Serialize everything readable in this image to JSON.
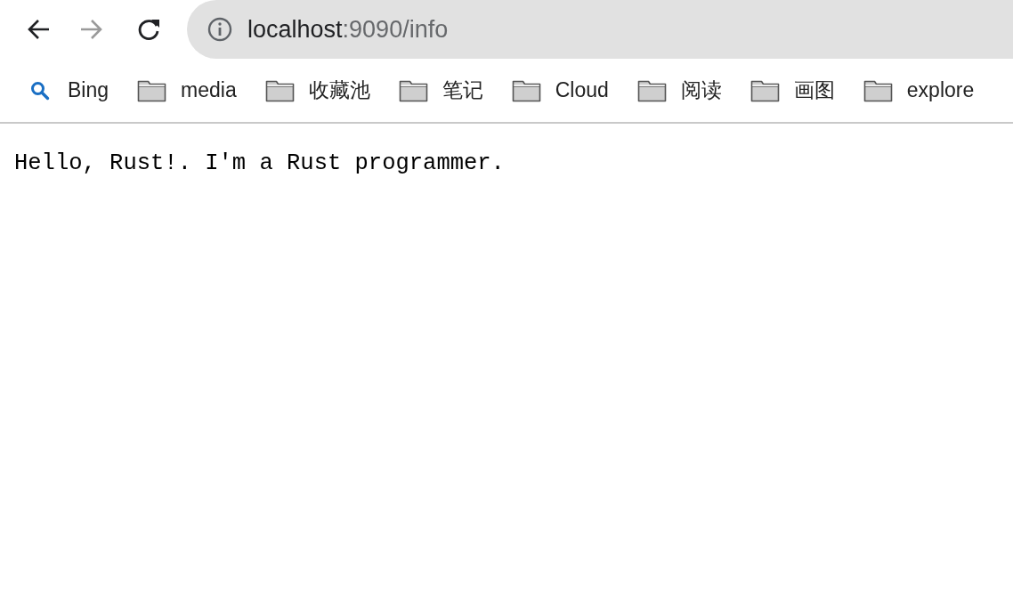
{
  "toolbar": {
    "back": {
      "disabled": false
    },
    "forward": {
      "disabled": true
    },
    "address": {
      "host": "localhost",
      "rest": ":9090/info"
    }
  },
  "bookmarks": [
    {
      "kind": "search",
      "label": "Bing"
    },
    {
      "kind": "folder",
      "label": "media"
    },
    {
      "kind": "folder",
      "label": "收藏池"
    },
    {
      "kind": "folder",
      "label": "笔记"
    },
    {
      "kind": "folder",
      "label": "Cloud"
    },
    {
      "kind": "folder",
      "label": "阅读"
    },
    {
      "kind": "folder",
      "label": "画图"
    },
    {
      "kind": "folder",
      "label": "explore"
    }
  ],
  "page": {
    "text": "Hello, Rust!. I'm a Rust programmer."
  }
}
